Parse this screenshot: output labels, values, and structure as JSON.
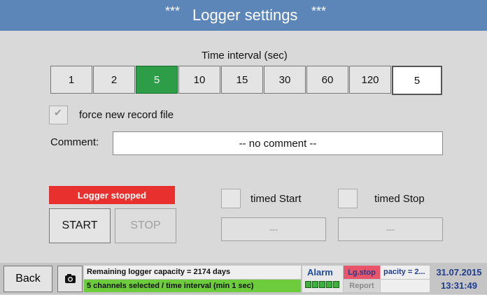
{
  "header": {
    "stars_left": "***",
    "title": "Logger settings",
    "stars_right": "***"
  },
  "interval": {
    "label": "Time interval (sec)",
    "options": [
      "1",
      "2",
      "5",
      "10",
      "15",
      "30",
      "60",
      "120"
    ],
    "selected": "5",
    "current_value": "5"
  },
  "force_new_record": {
    "label": "force new record file",
    "checked": true,
    "glyph": "✔"
  },
  "comment": {
    "label": "Comment:",
    "value": "-- no comment --"
  },
  "logger": {
    "status": "Logger stopped",
    "start_label": "START",
    "stop_label": "STOP"
  },
  "timed_start": {
    "label": "timed Start",
    "value": "---"
  },
  "timed_stop": {
    "label": "timed Stop",
    "value": "---"
  },
  "footer": {
    "back_label": "Back",
    "camera_icon": "camera-icon",
    "capacity_line": "Remaining logger capacity = 2174 days",
    "channels_line": "5 channels selected / time interval (min 1 sec)",
    "alarm_label": "Alarm",
    "lg_stop_label": "Lg.stop",
    "report_label": "Report",
    "capacity_short": "pacity = 2...",
    "date": "31.07.2015",
    "time": "13:31:49"
  },
  "colors": {
    "header": "#5d86b8",
    "selected": "#2d9d47",
    "status_red": "#e8312f",
    "status_green": "#6ccc3c",
    "lg_stop": "#e8546a",
    "text_blue": "#1f3d8c"
  }
}
